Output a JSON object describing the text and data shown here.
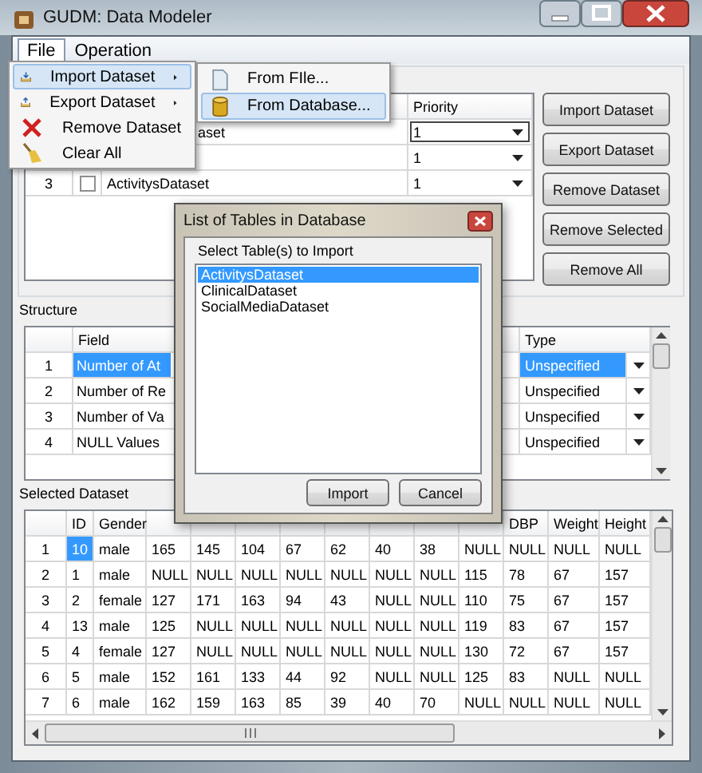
{
  "window": {
    "title": "GUDM: Data Modeler"
  },
  "menu_bar": [
    {
      "label": "File",
      "selected": true
    },
    {
      "label": "Operation",
      "selected": false
    }
  ],
  "datasets": {
    "priority_header": "Priority",
    "rows": [
      {
        "name": "aset",
        "priority": "1"
      },
      {
        "priority": "1"
      },
      {
        "number": "3",
        "checked": false,
        "name": "ActivitysDataset",
        "priority": "1"
      }
    ]
  },
  "dataset_buttons": [
    "Import Dataset",
    "Export Dataset",
    "Remove Dataset",
    "Remove Selected",
    "Remove All"
  ],
  "structure": {
    "title": "Structure",
    "field_header": "Field",
    "type_header": "Type",
    "rows": [
      {
        "number": "1",
        "field": "Number of At",
        "type": "Unspecified",
        "selected": true
      },
      {
        "number": "2",
        "field": "Number of Re",
        "type": "Unspecified",
        "selected": false
      },
      {
        "number": "3",
        "field": "Number of Va",
        "type": "Unspecified",
        "selected": false
      },
      {
        "number": "4",
        "field": "NULL Values",
        "type": "Unspecified",
        "selected": false
      }
    ]
  },
  "selected_dataset": {
    "title": "Selected Dataset",
    "left_columns": [
      "ID",
      "Gender"
    ],
    "right_columns": [
      "DBP",
      "Weight",
      "Height"
    ],
    "rows": [
      {
        "number": "1",
        "selected": true,
        "cells": [
          "10",
          "male",
          "165",
          "145",
          "104",
          "67",
          "62",
          "40",
          "38",
          "NULL",
          "NULL",
          "NULL",
          "NULL"
        ]
      },
      {
        "number": "2",
        "selected": false,
        "cells": [
          "1",
          "male",
          "NULL",
          "NULL",
          "NULL",
          "NULL",
          "NULL",
          "NULL",
          "NULL",
          "115",
          "78",
          "67",
          "157"
        ]
      },
      {
        "number": "3",
        "selected": false,
        "cells": [
          "2",
          "female",
          "127",
          "171",
          "163",
          "94",
          "43",
          "NULL",
          "NULL",
          "110",
          "75",
          "67",
          "157"
        ]
      },
      {
        "number": "4",
        "selected": false,
        "cells": [
          "13",
          "male",
          "125",
          "NULL",
          "NULL",
          "NULL",
          "NULL",
          "NULL",
          "NULL",
          "119",
          "83",
          "67",
          "157"
        ]
      },
      {
        "number": "5",
        "selected": false,
        "cells": [
          "4",
          "female",
          "127",
          "NULL",
          "NULL",
          "NULL",
          "NULL",
          "NULL",
          "NULL",
          "130",
          "72",
          "67",
          "157"
        ]
      },
      {
        "number": "6",
        "selected": false,
        "cells": [
          "5",
          "male",
          "152",
          "161",
          "133",
          "44",
          "92",
          "NULL",
          "NULL",
          "125",
          "83",
          "NULL",
          "NULL"
        ]
      },
      {
        "number": "7",
        "selected": false,
        "cells": [
          "6",
          "male",
          "162",
          "159",
          "163",
          "85",
          "39",
          "40",
          "70",
          "NULL",
          "NULL",
          "NULL",
          "NULL"
        ]
      }
    ]
  },
  "file_menu": [
    {
      "label": "Import Dataset",
      "kind": "import",
      "submenu": true,
      "selected": true
    },
    {
      "label": "Export Dataset",
      "kind": "export",
      "submenu": true,
      "selected": false
    },
    {
      "label": "Remove Dataset",
      "kind": "remove",
      "submenu": false,
      "selected": false
    },
    {
      "label": "Clear All",
      "kind": "clear",
      "submenu": false,
      "selected": false
    }
  ],
  "import_submenu": [
    {
      "label": "From FIle...",
      "kind": "file",
      "selected": false
    },
    {
      "label": "From Database...",
      "kind": "database",
      "selected": true
    }
  ],
  "dialog": {
    "title": "List of Tables in Database",
    "prompt": "Select Table(s) to Import",
    "tables": [
      {
        "label": "ActivitysDataset",
        "selected": true
      },
      {
        "label": "ClinicalDataset",
        "selected": false
      },
      {
        "label": "SocialMediaDataset",
        "selected": false
      }
    ],
    "buttons": [
      "Import",
      "Cancel"
    ]
  }
}
